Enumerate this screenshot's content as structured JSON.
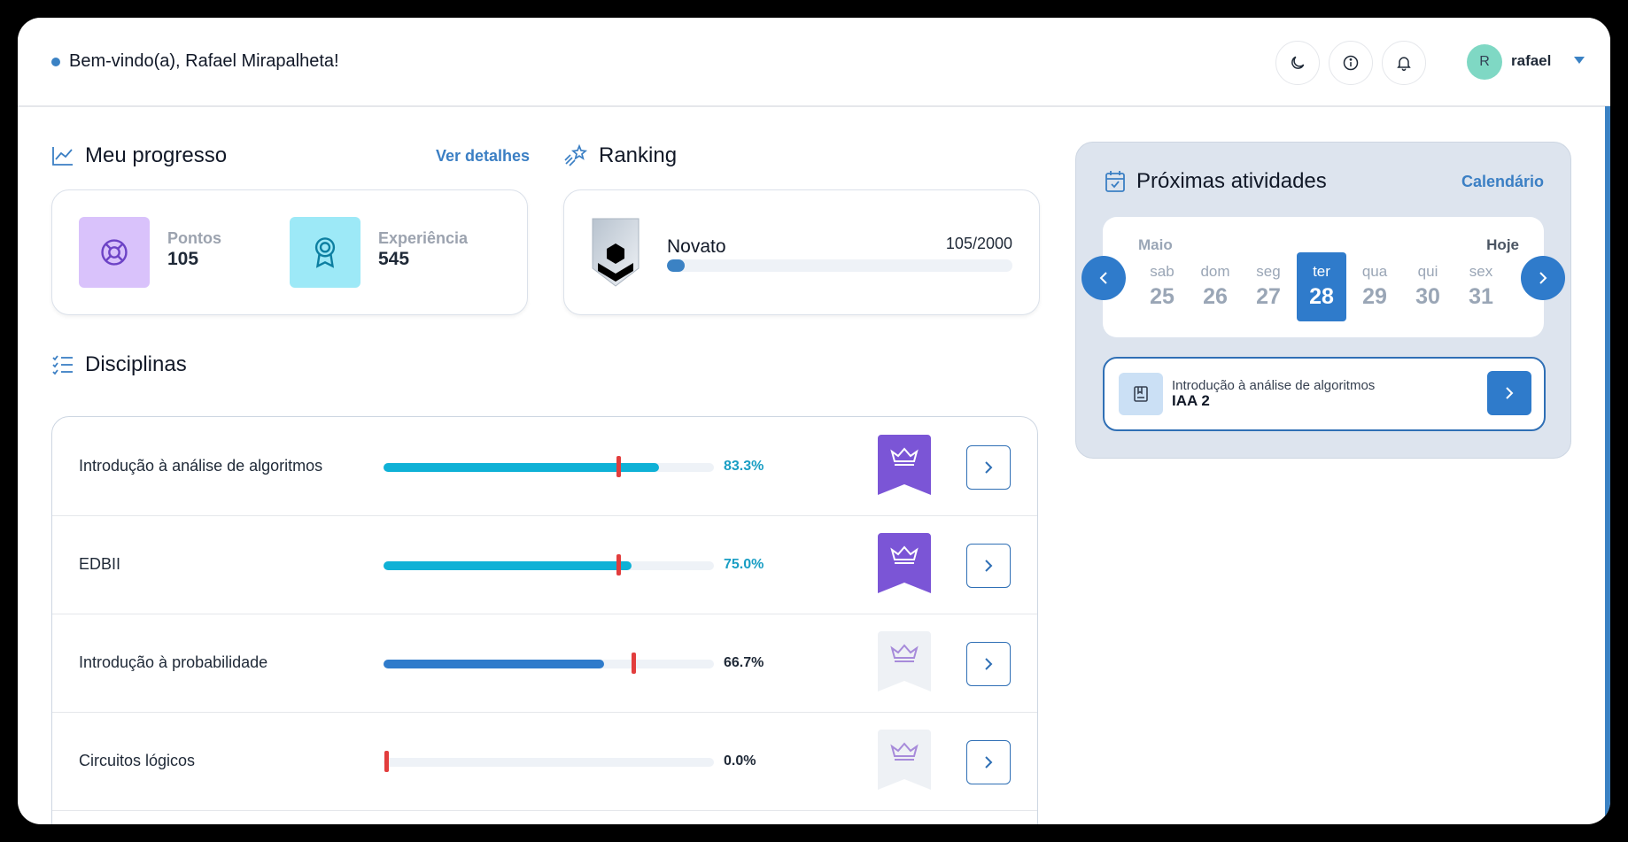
{
  "header": {
    "welcome": "Bem-vindo(a), Rafael Mirapalheta!",
    "user": {
      "initial": "R",
      "name": "rafael"
    }
  },
  "progress": {
    "title": "Meu progresso",
    "details_link": "Ver detalhes",
    "points": {
      "label": "Pontos",
      "value": "105"
    },
    "experience": {
      "label": "Experiência",
      "value": "545"
    }
  },
  "ranking": {
    "title": "Ranking",
    "level": "Novato",
    "count": "105/2000",
    "progress": 0.0525
  },
  "disciplines": {
    "title": "Disciplinas",
    "items": [
      {
        "name": "Introdução à análise de algoritmos",
        "percent": "83.3%",
        "fill": 0.833,
        "marker": 0.71,
        "fill_color": "#0fb1d6",
        "pct_color": "#1a9ec4",
        "badge_active": true
      },
      {
        "name": "EDBII",
        "percent": "75.0%",
        "fill": 0.75,
        "marker": 0.71,
        "fill_color": "#0fb1d6",
        "pct_color": "#1a9ec4",
        "badge_active": true
      },
      {
        "name": "Introdução à probabilidade",
        "percent": "66.7%",
        "fill": 0.667,
        "marker": 0.757,
        "fill_color": "#2f7bcb",
        "pct_color": "#1f2937",
        "badge_active": false
      },
      {
        "name": "Circuitos lógicos",
        "percent": "0.0%",
        "fill": 0.0,
        "marker": 0.007,
        "fill_color": "#2f7bcb",
        "pct_color": "#1f2937",
        "badge_active": false
      }
    ]
  },
  "activities": {
    "title": "Próximas atividades",
    "calendar_link": "Calendário",
    "month": "Maio",
    "today_label": "Hoje",
    "days": [
      {
        "name": "sab",
        "num": "25"
      },
      {
        "name": "dom",
        "num": "26"
      },
      {
        "name": "seg",
        "num": "27"
      },
      {
        "name": "ter",
        "num": "28",
        "selected": true
      },
      {
        "name": "qua",
        "num": "29"
      },
      {
        "name": "qui",
        "num": "30"
      },
      {
        "name": "sex",
        "num": "31"
      }
    ],
    "item": {
      "subject": "Introdução à análise de algoritmos",
      "name": "IAA 2"
    }
  },
  "colors": {
    "accent": "#2f7bcb",
    "marker": "#e23d3d",
    "badge_active": "#7b55d6",
    "badge_inactive": "#eef1f5"
  }
}
